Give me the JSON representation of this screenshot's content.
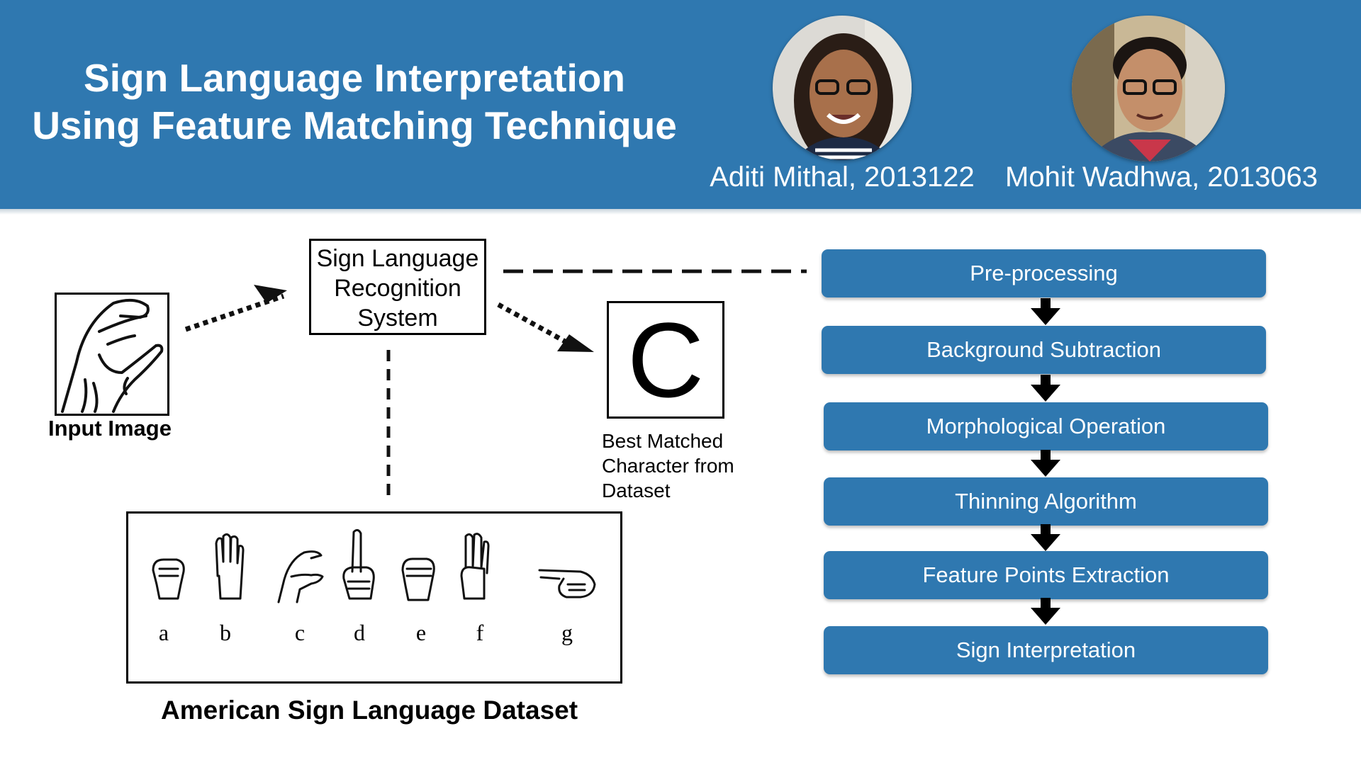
{
  "header": {
    "title_line1": "Sign Language Interpretation",
    "title_line2": "Using Feature Matching Technique",
    "authors": [
      {
        "name": "Aditi Mithal, 2013122"
      },
      {
        "name": "Mohit Wadhwa, 2013063"
      }
    ]
  },
  "diagram": {
    "input_label": "Input Image",
    "system_box": [
      "Sign Language",
      "Recognition",
      "System"
    ],
    "output_char": "C",
    "output_label": [
      "Best Matched",
      "Character from",
      "Dataset"
    ],
    "dataset_label": "American Sign Language Dataset",
    "dataset_letters": [
      "a",
      "b",
      "c",
      "d",
      "e",
      "f",
      "g"
    ]
  },
  "pipeline": {
    "steps": [
      "Pre-processing",
      "Background Subtraction",
      "Morphological Operation",
      "Thinning Algorithm",
      "Feature Points Extraction",
      "Sign Interpretation"
    ]
  },
  "colors": {
    "header_bg": "#2f78b0",
    "step_bg": "#2f78b0"
  },
  "icons": {
    "input_hand": "asl-letter-c-hand-icon",
    "dataset_hands": [
      "hand-a-icon",
      "hand-b-icon",
      "hand-c-icon",
      "hand-d-icon",
      "hand-e-icon",
      "hand-f-icon",
      "hand-g-icon"
    ]
  }
}
